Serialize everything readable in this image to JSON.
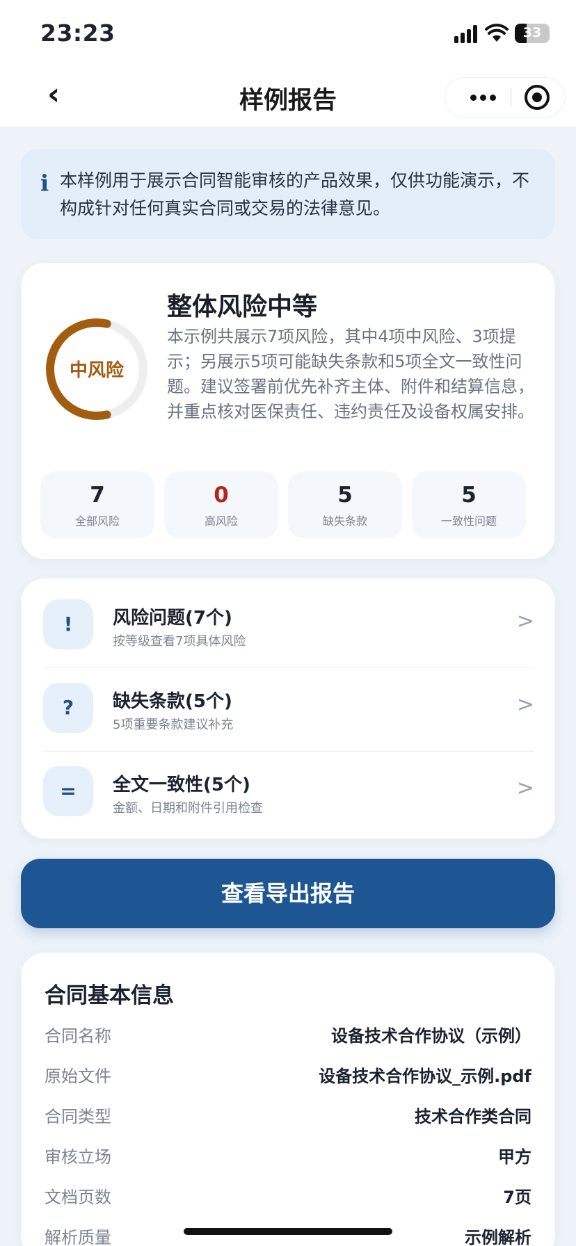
{
  "status_bar": {
    "time": "23:23",
    "battery": "33",
    "battery_level": 0.33
  },
  "nav": {
    "title": "样例报告"
  },
  "notice": {
    "text": "本样例用于展示合同智能审核的产品效果，仅供功能演示，不构成针对任何真实合同或交易的法律意见。"
  },
  "summary": {
    "badge": "中风险",
    "headline": "整体风险中等",
    "description": "本示例共展示7项风险，其中4项中风险、3项提示；另展示5项可能缺失条款和5项全文一致性问题。建议签署前优先补齐主体、附件和结算信息，并重点核对医保责任、违约责任及设备权属安排。",
    "ring_fraction": 0.57,
    "colors": {
      "ring": "#a35d10",
      "ring_track": "#eeeeee",
      "high_risk": "#b3261e",
      "accent": "#1e5693"
    },
    "stats": [
      {
        "value": "7",
        "label": "全部风险"
      },
      {
        "value": "0",
        "label": "高风险"
      },
      {
        "value": "5",
        "label": "缺失条款"
      },
      {
        "value": "5",
        "label": "一致性问题"
      }
    ]
  },
  "menu": [
    {
      "icon_char": "!",
      "icon": "alert-icon",
      "title": "风险问题(7个)",
      "subtitle": "按等级查看7项具体风险",
      "arrow": ">"
    },
    {
      "icon_char": "?",
      "icon": "question-icon",
      "title": "缺失条款(5个)",
      "subtitle": "5项重要条款建议补充",
      "arrow": ">"
    },
    {
      "icon_char": "=",
      "icon": "equals-icon",
      "title": "全文一致性(5个)",
      "subtitle": "金额、日期和附件引用检查",
      "arrow": ">"
    }
  ],
  "export_button": {
    "label": "查看导出报告"
  },
  "contract_info": {
    "title": "合同基本信息",
    "rows": [
      {
        "key": "合同名称",
        "value": "设备技术合作协议（示例）"
      },
      {
        "key": "原始文件",
        "value": "设备技术合作协议_示例.pdf"
      },
      {
        "key": "合同类型",
        "value": "技术合作类合同"
      },
      {
        "key": "审核立场",
        "value": "甲方"
      },
      {
        "key": "文档页数",
        "value": "7页"
      },
      {
        "key": "解析质量",
        "value": "示例解析"
      }
    ]
  }
}
